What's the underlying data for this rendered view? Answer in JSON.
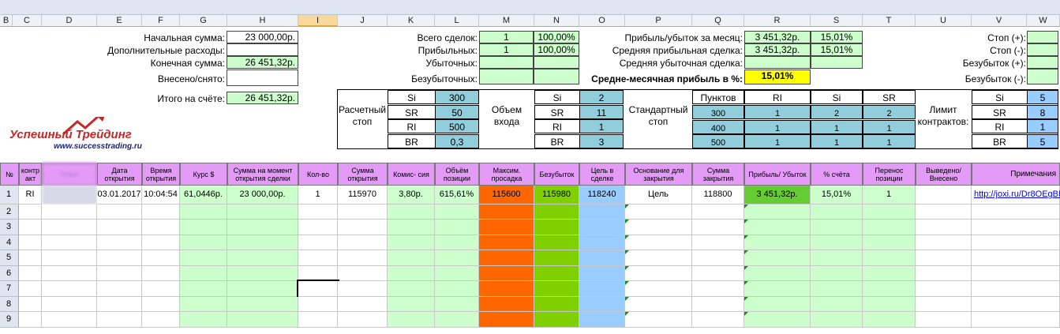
{
  "columns": [
    "B",
    "C",
    "D",
    "E",
    "F",
    "G",
    "H",
    "I",
    "J",
    "K",
    "L",
    "M",
    "N",
    "O",
    "P",
    "Q",
    "R",
    "S",
    "T",
    "U",
    "V",
    "W"
  ],
  "summary_left": {
    "start_label": "Начальная сумма:",
    "start_value": "23 000,00р.",
    "extra_label": "Дополнительные расходы:",
    "extra_value": "",
    "final_label": "Конечная сумма:",
    "final_value": "26 451,32р.",
    "deposit_label": "Внесено/снято:",
    "deposit_value": "",
    "total_label": "Итого на счёте:",
    "total_value": "26 451,32р."
  },
  "summary_mid": {
    "all_label": "Всего сделок:",
    "all_count": "1",
    "all_pct": "100,00%",
    "profit_label": "Прибыльных:",
    "profit_count": "1",
    "profit_pct": "100,00%",
    "loss_label": "Убыточных:",
    "be_label": "Безубыточных:"
  },
  "summary_right": {
    "month_label": "Прибыль/убыток за месяц:",
    "month_value": "3 451,32р.",
    "month_pct": "15,01%",
    "avgp_label": "Средняя прибыльная сделка:",
    "avgp_value": "3 451,32р.",
    "avgp_pct": "15,01%",
    "avgl_label": "Средняя убыточная сделка:",
    "monthly_label": "Средне-месячная прибыль в %:",
    "monthly_value": "15,01%"
  },
  "stops": {
    "stop_plus": "Стоп (+):",
    "stop_minus": "Стоп (-):",
    "be_plus": "Безубыток (+):",
    "be_minus": "Безубыток (-):"
  },
  "calc_stop": {
    "title": "Расчетный стоп",
    "rows": [
      [
        "Si",
        "300"
      ],
      [
        "SR",
        "50"
      ],
      [
        "RI",
        "500"
      ],
      [
        "BR",
        "0,3"
      ]
    ]
  },
  "entry_volume": {
    "title": "Объем входа",
    "rows": [
      [
        "Si",
        "2"
      ],
      [
        "SR",
        "11"
      ],
      [
        "RI",
        "1"
      ],
      [
        "BR",
        "3"
      ]
    ]
  },
  "std_stop": {
    "title": "Стандартный стоп",
    "headers": [
      "Пунктов",
      "RI",
      "Si",
      "SR"
    ],
    "rows": [
      [
        "300",
        "1",
        "2",
        "2"
      ],
      [
        "400",
        "1",
        "1",
        "1"
      ],
      [
        "500",
        "1",
        "1",
        "1"
      ]
    ]
  },
  "limit": {
    "title": "Лимит контрактов:",
    "rows": [
      [
        "Si",
        "5"
      ],
      [
        "SR",
        "8"
      ],
      [
        "RI",
        "1"
      ],
      [
        "BR",
        "5"
      ]
    ]
  },
  "logo": {
    "title": "Успешный Трейдинг",
    "url": "www.successtrading.ru"
  },
  "table_headers": [
    "№",
    "контр акт",
    "Ticker",
    "Дата открытия",
    "Время открытия",
    "Курс $",
    "Сумма на момент открытия сделки",
    "Кол-во",
    "Сумма открытия",
    "Комис- сия",
    "Объём позиции",
    "Максим. просадка",
    "Безубыток",
    "Цель в сделке",
    "Основание для закрытия",
    "Сумма закрытия",
    "Прибыль/ Убыток",
    "% счёта",
    "Перенос позиции",
    "Выведено/ Внесено",
    "Примечания"
  ],
  "row1": [
    "1",
    "RI",
    "",
    "03.01.2017",
    "10:04:54",
    "61,0446р.",
    "23 000,00р.",
    "1",
    "115970",
    "3,80р.",
    "615,61%",
    "115600",
    "115980",
    "118240",
    "Цель",
    "118800",
    "3 451,32р.",
    "15,01%",
    "1",
    "",
    "http://joxi.ru/Dr8OEgBH"
  ],
  "row_numbers": [
    "2",
    "3",
    "4",
    "5",
    "6",
    "7",
    "8",
    "9"
  ]
}
